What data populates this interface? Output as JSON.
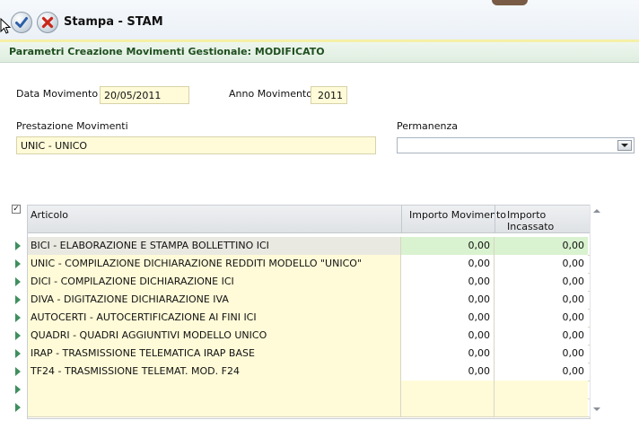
{
  "window": {
    "title": "Stampa - STAM",
    "confirm_icon": "check-icon",
    "cancel_icon": "x-icon"
  },
  "header": {
    "subtitle": "Parametri Creazione Movimenti Gestionale: MODIFICATO"
  },
  "form": {
    "data_movimento_label": "Data Movimento",
    "data_movimento_value": "20/05/2011",
    "anno_movimento_label": "Anno Movimento",
    "anno_movimento_value": "2011",
    "prestazione_label": "Prestazione Movimenti",
    "prestazione_value": "UNIC - UNICO",
    "permanenza_label": "Permanenza",
    "permanenza_value": ""
  },
  "grid": {
    "columns": [
      "Articolo",
      "Importo Movimento",
      "Importo Incassato"
    ],
    "rows": [
      {
        "articolo": "BICI - ELABORAZIONE E STAMPA  BOLLETTINO ICI",
        "importo_movimento": "0,00",
        "importo_incassato": "0,00"
      },
      {
        "articolo": "UNIC - COMPILAZIONE DICHIARAZIONE REDDITI MODELLO \"UNICO\"",
        "importo_movimento": "0,00",
        "importo_incassato": "0,00"
      },
      {
        "articolo": "DICI - COMPILAZIONE DICHIARAZIONE ICI",
        "importo_movimento": "0,00",
        "importo_incassato": "0,00"
      },
      {
        "articolo": "DIVA - DIGITAZIONE DICHIARAZIONE IVA",
        "importo_movimento": "0,00",
        "importo_incassato": "0,00"
      },
      {
        "articolo": "AUTOCERTI - AUTOCERTIFICAZIONE AI FINI ICI",
        "importo_movimento": "0,00",
        "importo_incassato": "0,00"
      },
      {
        "articolo": "QUADRI - QUADRI AGGIUNTIVI MODELLO  UNICO",
        "importo_movimento": "0,00",
        "importo_incassato": "0,00"
      },
      {
        "articolo": "IRAP - TRASMISSIONE  TELEMATICA IRAP BASE",
        "importo_movimento": "0,00",
        "importo_incassato": "0,00"
      },
      {
        "articolo": "TF24 - TRASMISSIONE TELEMAT. MOD. F24",
        "importo_movimento": "0,00",
        "importo_incassato": "0,00"
      },
      {
        "articolo": "",
        "importo_movimento": "",
        "importo_incassato": ""
      },
      {
        "articolo": "",
        "importo_movimento": "",
        "importo_incassato": ""
      }
    ]
  },
  "colors": {
    "field_bg": "#fffbd8",
    "selected_amount_bg": "#d9f2cf",
    "row_arrow": "#3f8f5f",
    "subheader_text": "#1f4f1f"
  }
}
